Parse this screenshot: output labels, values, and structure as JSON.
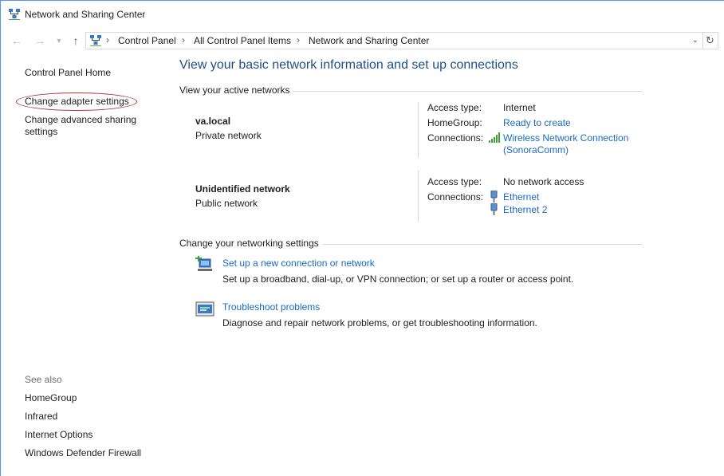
{
  "window": {
    "title": "Network and Sharing Center"
  },
  "address_bar": {
    "breadcrumbs": [
      "Control Panel",
      "All Control Panel Items",
      "Network and Sharing Center"
    ]
  },
  "left_pane": {
    "links": [
      "Control Panel Home",
      "Change adapter settings",
      "Change advanced sharing",
      "settings"
    ],
    "see_also_heading": "See also",
    "see_also": [
      "HomeGroup",
      "Infrared",
      "Internet Options",
      "Windows Defender Firewall"
    ]
  },
  "main": {
    "title": "View your basic network information and set up connections",
    "active_networks_heading": "View your active networks",
    "networks": [
      {
        "name": "va.local",
        "type": "Private network",
        "access_label": "Access type:",
        "access_value": "Internet",
        "homegroup_label": "HomeGroup:",
        "homegroup_value": "Ready to create",
        "connections_label": "Connections:",
        "connections": [
          "Wireless Network Connection",
          "(SonoraComm)"
        ]
      },
      {
        "name": "Unidentified network",
        "type": "Public network",
        "access_label": "Access type:",
        "access_value": "No network access",
        "connections_label": "Connections:",
        "connections": [
          "Ethernet",
          "Ethernet 2"
        ]
      }
    ],
    "settings_heading": "Change your networking settings",
    "tasks": [
      {
        "icon": "new-connection-icon",
        "link": "Set up a new connection or network",
        "desc": "Set up a broadband, dial-up, or VPN connection; or set up a router or access point."
      },
      {
        "icon": "troubleshoot-icon",
        "link": "Troubleshoot problems",
        "desc": "Diagnose and repair network problems, or get troubleshooting information."
      }
    ]
  },
  "colors": {
    "link": "#1a6ac6",
    "title": "#1e4e8c",
    "window_border": "#4c9be8",
    "annotation_circle": "#b33030"
  }
}
